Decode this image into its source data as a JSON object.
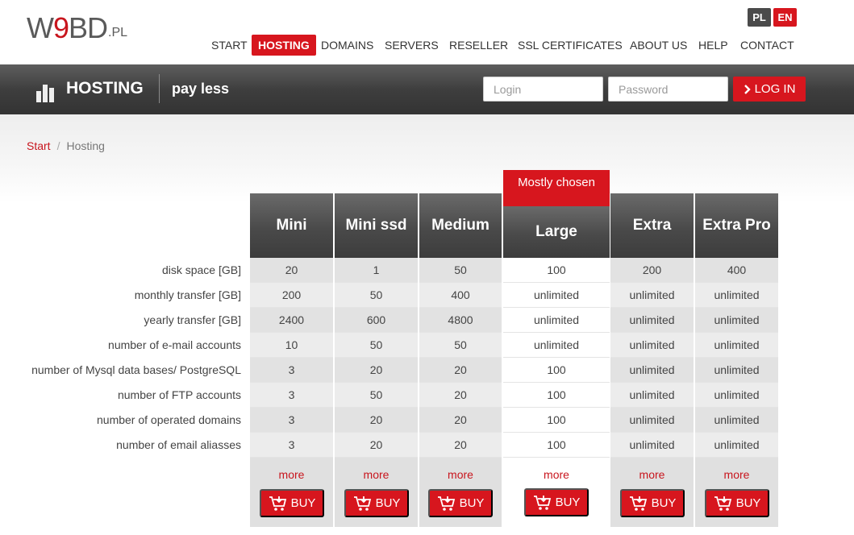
{
  "logo": {
    "main_prefix": "W",
    "main_red": "9",
    "main_rest": "BD",
    "suffix": ".PL"
  },
  "lang": {
    "pl": "PL",
    "en": "EN"
  },
  "nav": [
    "START",
    "HOSTING",
    "DOMAINS",
    "SERVERS",
    "RESELLER",
    "SSL CERTIFICATES",
    "ABOUT US",
    "HELP",
    "CONTACT"
  ],
  "nav_active": "HOSTING",
  "band": {
    "title": "HOSTING",
    "subtitle": "pay less"
  },
  "login": {
    "login_placeholder": "Login",
    "password_placeholder": "Password",
    "button": "LOG IN"
  },
  "breadcrumb": {
    "home": "Start",
    "current": "Hosting",
    "separator": "/"
  },
  "pricing": {
    "badge": "Mostly chosen",
    "plans": [
      "Mini",
      "Mini ssd",
      "Medium",
      "Large",
      "Extra",
      "Extra Pro"
    ],
    "rows": [
      {
        "label": "disk space [GB]",
        "values": [
          "20",
          "1",
          "50",
          "100",
          "200",
          "400"
        ]
      },
      {
        "label": "monthly transfer [GB]",
        "values": [
          "200",
          "50",
          "400",
          "unlimited",
          "unlimited",
          "unlimited"
        ]
      },
      {
        "label": "yearly transfer [GB]",
        "values": [
          "2400",
          "600",
          "4800",
          "unlimited",
          "unlimited",
          "unlimited"
        ]
      },
      {
        "label": "number of e-mail accounts",
        "values": [
          "10",
          "50",
          "50",
          "unlimited",
          "unlimited",
          "unlimited"
        ]
      },
      {
        "label": "number of Mysql data bases/ PostgreSQL",
        "values": [
          "3",
          "20",
          "20",
          "100",
          "unlimited",
          "unlimited"
        ]
      },
      {
        "label": "number of FTP accounts",
        "values": [
          "3",
          "50",
          "20",
          "100",
          "unlimited",
          "unlimited"
        ]
      },
      {
        "label": "number of operated domains",
        "values": [
          "3",
          "20",
          "20",
          "100",
          "unlimited",
          "unlimited"
        ]
      },
      {
        "label": "number of email aliasses",
        "values": [
          "3",
          "20",
          "20",
          "100",
          "unlimited",
          "unlimited"
        ]
      }
    ],
    "more_label": "more",
    "buy_label": "BUY"
  },
  "colors": {
    "accent": "#d7161e",
    "dark": "#3c3c3c"
  }
}
